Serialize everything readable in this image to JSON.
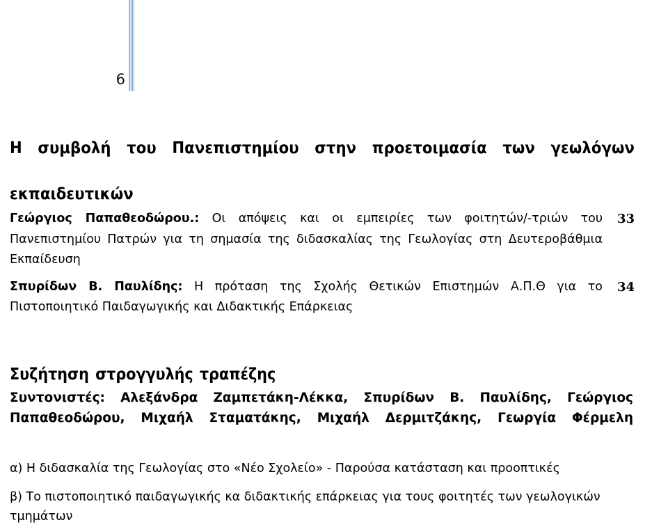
{
  "page": {
    "number": "6",
    "rule_color": "#9fb9d4"
  },
  "title": {
    "line1": "Η συμβολή του Πανεπιστημίου  στην προετοιμασία των γεωλόγων",
    "line2": "εκπαιδευτικών"
  },
  "entries": [
    {
      "author": "Γεώργιος Παπαθεοδώρου.:",
      "text": " Οι απόψεις και οι εμπειρίες των φοιτητών/-τριών του Πανεπιστημίου Πατρών για τη σημασία της διδασκαλίας της Γεωλογίας στη Δευτεροβάθμια Εκπαίδευση",
      "pageno": "33"
    },
    {
      "author": "Σπυρίδων Β. Παυλίδης:",
      "text": " Η πρόταση της Σχολής Θετικών Επιστημών Α.Π.Θ για το Πιστοποιητικό Παιδαγωγικής και Διδακτικής Επάρκειας",
      "pageno": "34"
    }
  ],
  "roundtable": {
    "heading": "Συζήτηση στρογγυλής  τραπέζης",
    "moderators": "Συντονιστές: Αλεξάνδρα Ζαμπετάκη-Λέκκα, Σπυρίδων Β. Παυλίδης, Γεώργιος Παπαθεοδώρου, Μιχαήλ Σταματάκης, Μιχαήλ  Δερμιτζάκης, Γεωργία Φέρμελη",
    "topics": [
      "α) Η διδασκαλία της Γεωλογίας στο «Νέο Σχολείο» - Παρούσα κατάσταση και  προοπτικές",
      "β) Το πιστοποιητικό παιδαγωγικής κα διδακτικής επάρκειας για τους φοιτητές  των γεωλογικών τμημάτων"
    ]
  }
}
